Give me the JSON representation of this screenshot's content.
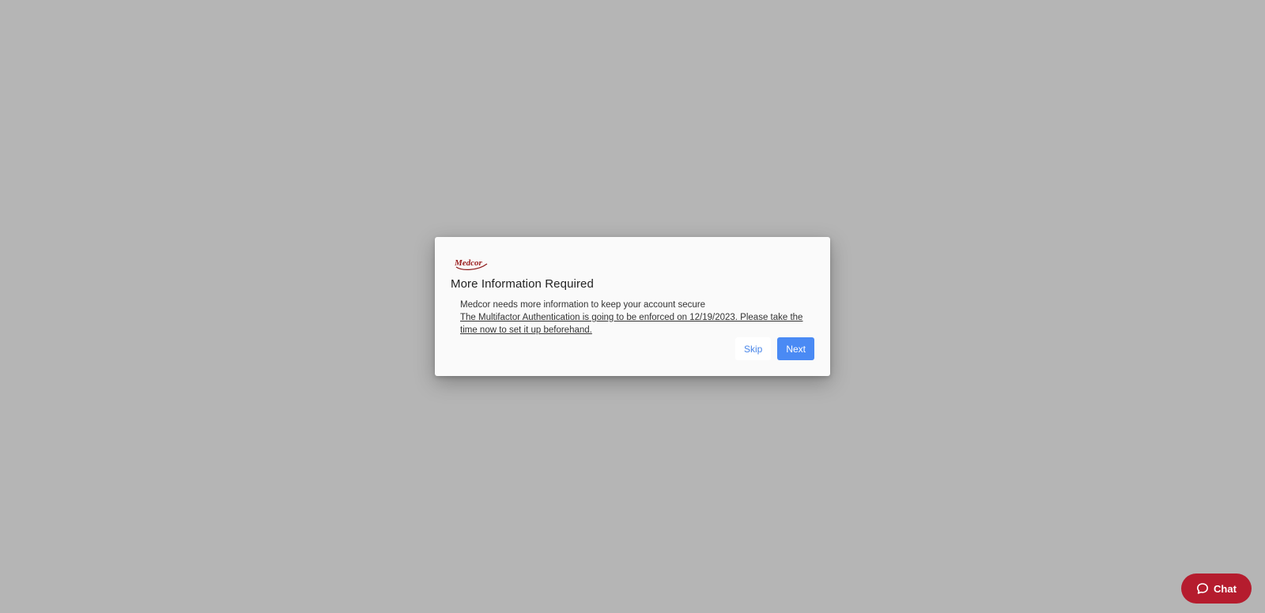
{
  "dialog": {
    "logo_text": "Medcor",
    "title": "More Information Required",
    "message": "Medcor needs more information to keep your account secure",
    "notice": "The Multifactor Authentication is going to be enforced on 12/19/2023. Please take the time now to set it up beforehand.",
    "skip_label": "Skip",
    "next_label": "Next"
  },
  "chat": {
    "label": "Chat",
    "icon": "chat-bubble-icon"
  },
  "colors": {
    "overlay": "#b5b5b5",
    "primary": "#4a8af4",
    "brand": "#b51c2e"
  }
}
